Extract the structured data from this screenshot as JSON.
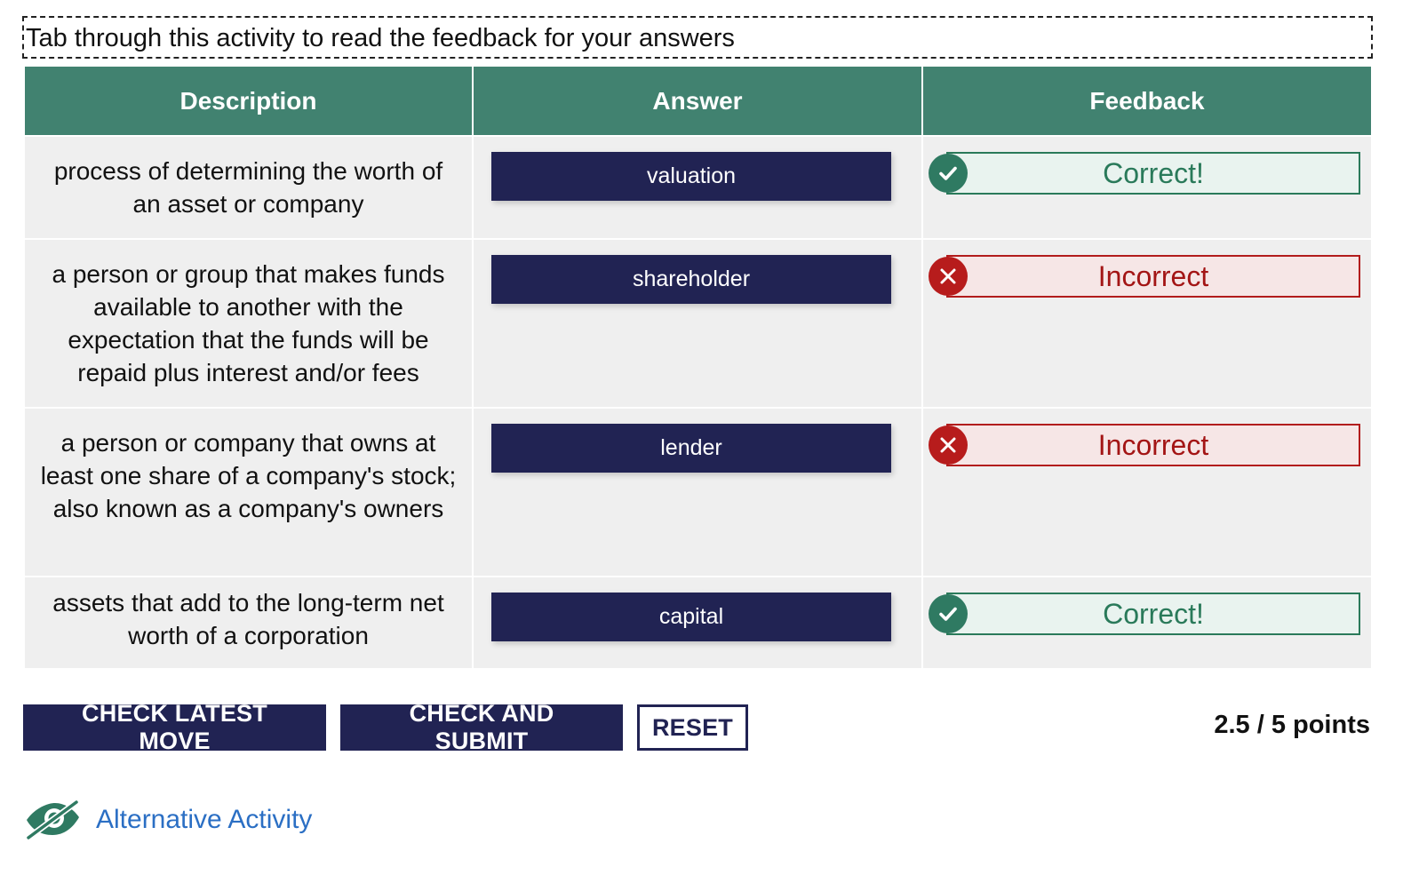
{
  "instructions": "Tab through this activity to read the feedback for your answers",
  "headers": {
    "description": "Description",
    "answer": "Answer",
    "feedback": "Feedback"
  },
  "rows": [
    {
      "description": "process of determining the worth of an asset or company",
      "answer": "valuation",
      "feedback": "Correct!",
      "status": "correct",
      "status_icon": "check-circle-icon"
    },
    {
      "description": "a person or group that makes funds available to another with the expectation that the funds will be repaid plus interest and/or fees",
      "answer": "shareholder",
      "feedback": "Incorrect",
      "status": "incorrect",
      "status_icon": "x-circle-icon"
    },
    {
      "description": "a person or company that owns at least one share of a company's stock; also known as a company's owners",
      "answer": "lender",
      "feedback": "Incorrect",
      "status": "incorrect",
      "status_icon": "x-circle-icon"
    },
    {
      "description": "assets that add to the long-term net worth of a corporation",
      "answer": "capital",
      "feedback": "Correct!",
      "status": "correct",
      "status_icon": "check-circle-icon"
    }
  ],
  "actions": {
    "check_latest": "CHECK LATEST MOVE",
    "check_submit": "CHECK AND SUBMIT",
    "reset": "RESET"
  },
  "score": {
    "text": "2.5 / 5 points",
    "earned": 2.5,
    "total": 5
  },
  "alternative": {
    "label": "Alternative Activity",
    "icon": "eye-slash-icon"
  },
  "colors": {
    "header_bg": "#418270",
    "answer_bg": "#212353",
    "correct": "#2a7a5a",
    "incorrect": "#b21c1c",
    "link": "#2b6fc4"
  }
}
